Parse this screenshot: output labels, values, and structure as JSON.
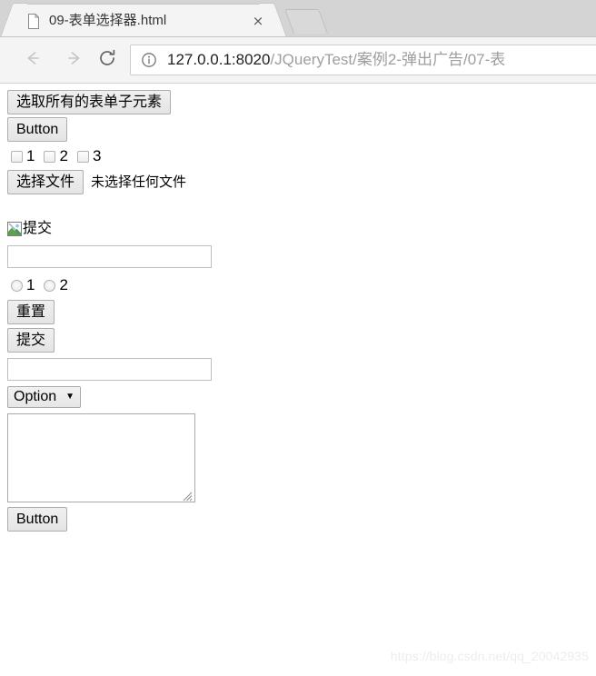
{
  "browser": {
    "tab": {
      "title": "09-表单选择器.html",
      "favicon": "document-icon",
      "close": "×"
    },
    "newtab_label": "new-tab-button",
    "nav": {
      "back": "back-arrow-icon",
      "forward": "forward-arrow-icon",
      "reload": "reload-icon"
    },
    "omnibox": {
      "security_icon": "info-circle-icon",
      "url_host": "127.0.0.1:8020",
      "url_path": "/JQueryTest/案例2-弹出广告/07-表",
      "url_full": "127.0.0.1:8020/JQueryTest/案例2-弹出广告/07-表"
    }
  },
  "page": {
    "select_all_button": "选取所有的表单子元素",
    "button1": "Button",
    "checkboxes": [
      {
        "label": "1",
        "checked": false
      },
      {
        "label": "2",
        "checked": false
      },
      {
        "label": "3",
        "checked": false
      }
    ],
    "file_input": {
      "button_label": "选择文件",
      "status": "未选择任何文件"
    },
    "image_submit": {
      "alt": "提交",
      "icon": "broken-image-icon"
    },
    "text_input_1": {
      "value": "",
      "placeholder": ""
    },
    "radios": [
      {
        "label": "1",
        "checked": false
      },
      {
        "label": "2",
        "checked": false
      }
    ],
    "reset_button": "重置",
    "submit_button": "提交",
    "text_input_2": {
      "value": "",
      "placeholder": ""
    },
    "select": {
      "selected": "Option",
      "arrow": "▼",
      "options": [
        "Option"
      ]
    },
    "textarea": {
      "value": "",
      "placeholder": ""
    },
    "button2": "Button",
    "watermark": "https://blog.csdn.net/qq_20042935"
  }
}
